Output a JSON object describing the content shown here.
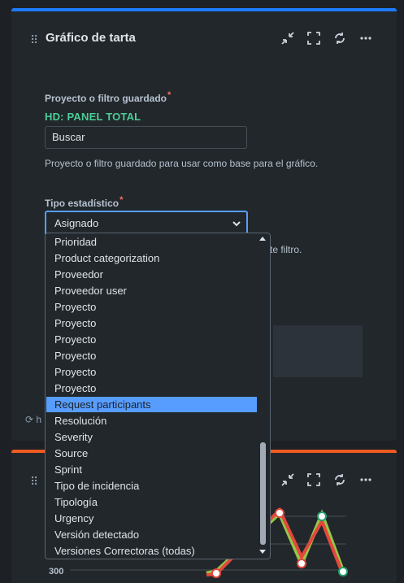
{
  "gadget1": {
    "title": "Gráfico de tarta",
    "project_label": "Proyecto o filtro guardado",
    "required_mark": "*",
    "project_value": "HD: PANEL TOTAL",
    "search_value": "Buscar",
    "project_help": "Proyecto o filtro guardado para usar como base para el gráfico.",
    "stat_label": "Tipo estadístico",
    "stat_selected": "Asignado",
    "stat_help_tail": "te filtro.",
    "footer_partial": "h"
  },
  "dropdown": {
    "options": [
      "Prioridad",
      "Product categorization",
      "Proveedor",
      "Proveedor user",
      "Proyecto",
      "Proyecto",
      "Proyecto",
      "Proyecto",
      "Proyecto",
      "Proyecto",
      "Request participants",
      "Resolución",
      "Severity",
      "Source",
      "Sprint",
      "Tipo de incidencia",
      "Tipología",
      "Urgency",
      "Versión detectado",
      "Versiones Correctoras (todas)"
    ],
    "highlighted_index": 10
  },
  "gadget2": {
    "tick_label": "300"
  },
  "icons": {
    "handle": "drag-handle-icon",
    "minimize": "minimize-icon",
    "fullscreen": "fullscreen-icon",
    "refresh": "refresh-icon",
    "more": "more-icon"
  },
  "colors": {
    "accent_blue": "#1d7afc",
    "accent_orange": "#f15b22",
    "project_green": "#4bce97",
    "highlight": "#579dff",
    "series_red": "#e2483d",
    "series_olive": "#94c748",
    "point_green": "#22a06b"
  }
}
